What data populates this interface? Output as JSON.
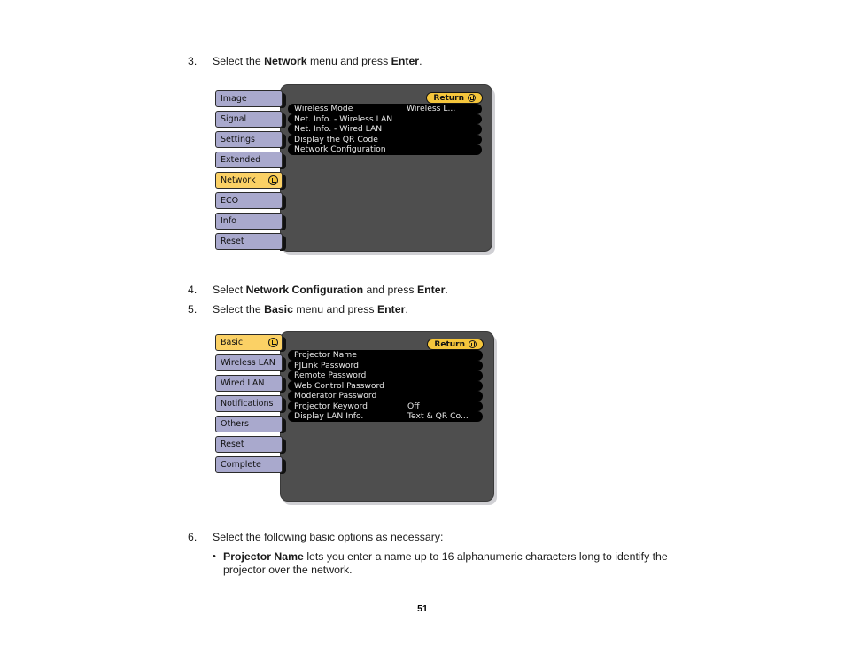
{
  "page": {
    "number": "51"
  },
  "steps": [
    {
      "num": "3.",
      "parts": [
        {
          "t": "Select the ",
          "b": false
        },
        {
          "t": "Network",
          "b": true
        },
        {
          "t": " menu and press ",
          "b": false
        },
        {
          "t": "Enter",
          "b": true
        },
        {
          "t": ".",
          "b": false
        }
      ]
    },
    {
      "num": "4.",
      "parts": [
        {
          "t": "Select ",
          "b": false
        },
        {
          "t": "Network Configuration",
          "b": true
        },
        {
          "t": " and press ",
          "b": false
        },
        {
          "t": "Enter",
          "b": true
        },
        {
          "t": ".",
          "b": false
        }
      ]
    },
    {
      "num": "5.",
      "parts": [
        {
          "t": "Select the ",
          "b": false
        },
        {
          "t": "Basic",
          "b": true
        },
        {
          "t": " menu and press ",
          "b": false
        },
        {
          "t": "Enter",
          "b": true
        },
        {
          "t": ".",
          "b": false
        }
      ]
    },
    {
      "num": "6.",
      "parts": [
        {
          "t": "Select the following basic options as necessary:",
          "b": false
        }
      ]
    }
  ],
  "bullets": [
    {
      "marker": "•",
      "parts": [
        {
          "t": "Projector Name",
          "b": true
        },
        {
          "t": " lets you enter a name up to 16 alphanumeric characters long to identify the projector over the network.",
          "b": false
        }
      ]
    }
  ],
  "osd_network": {
    "return_label": "Return",
    "return_icon": "enter-key-icon",
    "tabs": [
      {
        "label": "Image",
        "selected": false,
        "icon": null
      },
      {
        "label": "Signal",
        "selected": false,
        "icon": null
      },
      {
        "label": "Settings",
        "selected": false,
        "icon": null
      },
      {
        "label": "Extended",
        "selected": false,
        "icon": null
      },
      {
        "label": "Network",
        "selected": true,
        "icon": "enter-key-icon"
      },
      {
        "label": "ECO",
        "selected": false,
        "icon": null
      },
      {
        "label": "Info",
        "selected": false,
        "icon": null
      },
      {
        "label": "Reset",
        "selected": false,
        "icon": null
      }
    ],
    "items": [
      {
        "label": "Wireless Mode",
        "value": "Wireless L..."
      },
      {
        "label": "Net. Info. - Wireless LAN",
        "value": ""
      },
      {
        "label": "Net. Info. - Wired LAN",
        "value": ""
      },
      {
        "label": "Display the QR Code",
        "value": ""
      },
      {
        "label": "Network Configuration",
        "value": ""
      }
    ]
  },
  "osd_basic": {
    "return_label": "Return",
    "return_icon": "enter-key-icon",
    "tabs": [
      {
        "label": "Basic",
        "selected": true,
        "icon": "enter-key-icon"
      },
      {
        "label": "Wireless LAN",
        "selected": false,
        "icon": null
      },
      {
        "label": "Wired LAN",
        "selected": false,
        "icon": null
      },
      {
        "label": "Notifications",
        "selected": false,
        "icon": null
      },
      {
        "label": "Others",
        "selected": false,
        "icon": null
      },
      {
        "label": "Reset",
        "selected": false,
        "icon": null
      },
      {
        "label": "Complete",
        "selected": false,
        "icon": null
      }
    ],
    "items": [
      {
        "label": "Projector Name",
        "value": ""
      },
      {
        "label": "PJLink Password",
        "value": ""
      },
      {
        "label": "Remote Password",
        "value": ""
      },
      {
        "label": "Web Control Password",
        "value": ""
      },
      {
        "label": "Moderator Password",
        "value": ""
      },
      {
        "label": "Projector Keyword",
        "value": "Off"
      },
      {
        "label": "Display LAN Info.",
        "value": "Text & QR Co..."
      }
    ]
  },
  "colors": {
    "tab_normal": "#a9a9cd",
    "tab_selected": "#fbd165",
    "panel_bg": "#4e4e4e",
    "row_bg": "#000000",
    "return_bg": "#f5c63c",
    "page_bg": "#ffffff"
  }
}
